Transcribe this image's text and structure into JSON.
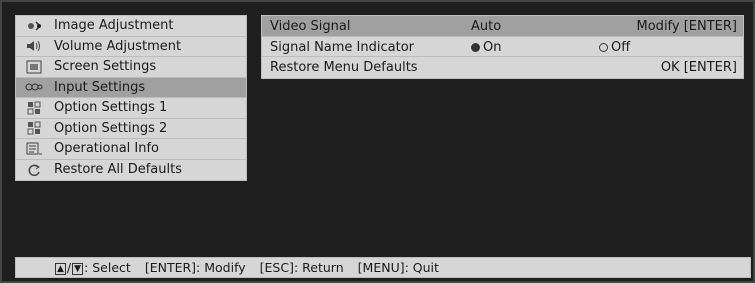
{
  "menu": {
    "items": [
      {
        "label": "Image Adjustment",
        "icon": "image-adjustment-icon"
      },
      {
        "label": "Volume Adjustment",
        "icon": "volume-icon"
      },
      {
        "label": "Screen Settings",
        "icon": "screen-settings-icon"
      },
      {
        "label": "Input Settings",
        "icon": "input-settings-icon"
      },
      {
        "label": "Option Settings 1",
        "icon": "option-settings-icon"
      },
      {
        "label": "Option Settings 2",
        "icon": "option-settings-icon"
      },
      {
        "label": "Operational Info",
        "icon": "operational-info-icon"
      },
      {
        "label": "Restore All Defaults",
        "icon": "restore-icon"
      }
    ],
    "selected_index": 3
  },
  "panel": {
    "video_signal": {
      "label": "Video Signal",
      "value": "Auto",
      "action": "Modify [ENTER]"
    },
    "signal_name_indicator": {
      "label": "Signal Name Indicator",
      "on_label": "On",
      "off_label": "Off",
      "selected": "On"
    },
    "restore_menu_defaults": {
      "label": "Restore Menu Defaults",
      "action": "OK [ENTER]"
    }
  },
  "helpbar": {
    "select": "Select",
    "modify_key": "[ENTER]",
    "modify": "Modify",
    "return_key": "[ESC]",
    "return": "Return",
    "quit_key": "[MENU]",
    "quit": "Quit"
  }
}
